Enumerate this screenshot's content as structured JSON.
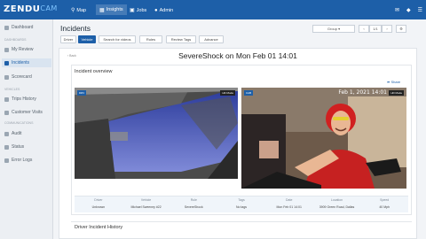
{
  "brand": {
    "name": "ZENDU",
    "sub": "CAM"
  },
  "topnav": [
    {
      "icon": "map-pin-icon",
      "glyph": "⚲",
      "label": "Map"
    },
    {
      "icon": "insights-icon",
      "glyph": "▦",
      "label": "Insights"
    },
    {
      "icon": "jobs-icon",
      "glyph": "▣",
      "label": "Jobs"
    },
    {
      "icon": "user-icon",
      "glyph": "●",
      "label": "Admin"
    }
  ],
  "sidebar": {
    "sections": [
      "Dashboards",
      "Vehicles",
      "Communications"
    ],
    "items": [
      {
        "label": "Dashboard",
        "active": false
      },
      {
        "label": "My Review",
        "active": false
      },
      {
        "label": "Incidents",
        "active": true
      },
      {
        "label": "Scorecard",
        "active": false
      },
      {
        "label": "Trips History",
        "active": false
      },
      {
        "label": "Customer Visits",
        "active": false
      },
      {
        "label": "Audit",
        "active": false
      },
      {
        "label": "Status",
        "active": false
      },
      {
        "label": "Error Logs",
        "active": false
      }
    ]
  },
  "page": {
    "title": "Incidents"
  },
  "tabs": [
    {
      "label": "Driver",
      "active": false
    },
    {
      "label": "Vehicle",
      "active": true
    },
    {
      "label": "Search for videos",
      "active": false
    },
    {
      "label": "Rules",
      "active": false
    },
    {
      "label": "Review Tags",
      "active": false
    },
    {
      "label": "Advance",
      "active": false
    }
  ],
  "toolbar": {
    "group_label": "Group",
    "btn1": "‹",
    "btn2": "1/1",
    "btn3": "›"
  },
  "event": {
    "back_label": "‹ Back",
    "title": "SevereShock on Mon Feb 01 14:01",
    "overview_label": "Incident overview",
    "share_label": "Share"
  },
  "cameras": [
    {
      "badge": "DRV",
      "rec": "HD Mode"
    },
    {
      "badge": "CAB",
      "rec": "HD Mode",
      "date": "Feb 1, 2021  14:01"
    }
  ],
  "meta": {
    "headers": [
      "Driver",
      "Vehicle",
      "Rule",
      "Tags",
      "Date",
      "Location",
      "Speed"
    ],
    "values": [
      "Unknown",
      "Michael Sweeney #22",
      "SevereShock",
      "No tags",
      "Mon Feb 01 14:01",
      "3909 Green Road, Dallas",
      "40 Mph"
    ]
  },
  "history_label": "Driver Incident History"
}
